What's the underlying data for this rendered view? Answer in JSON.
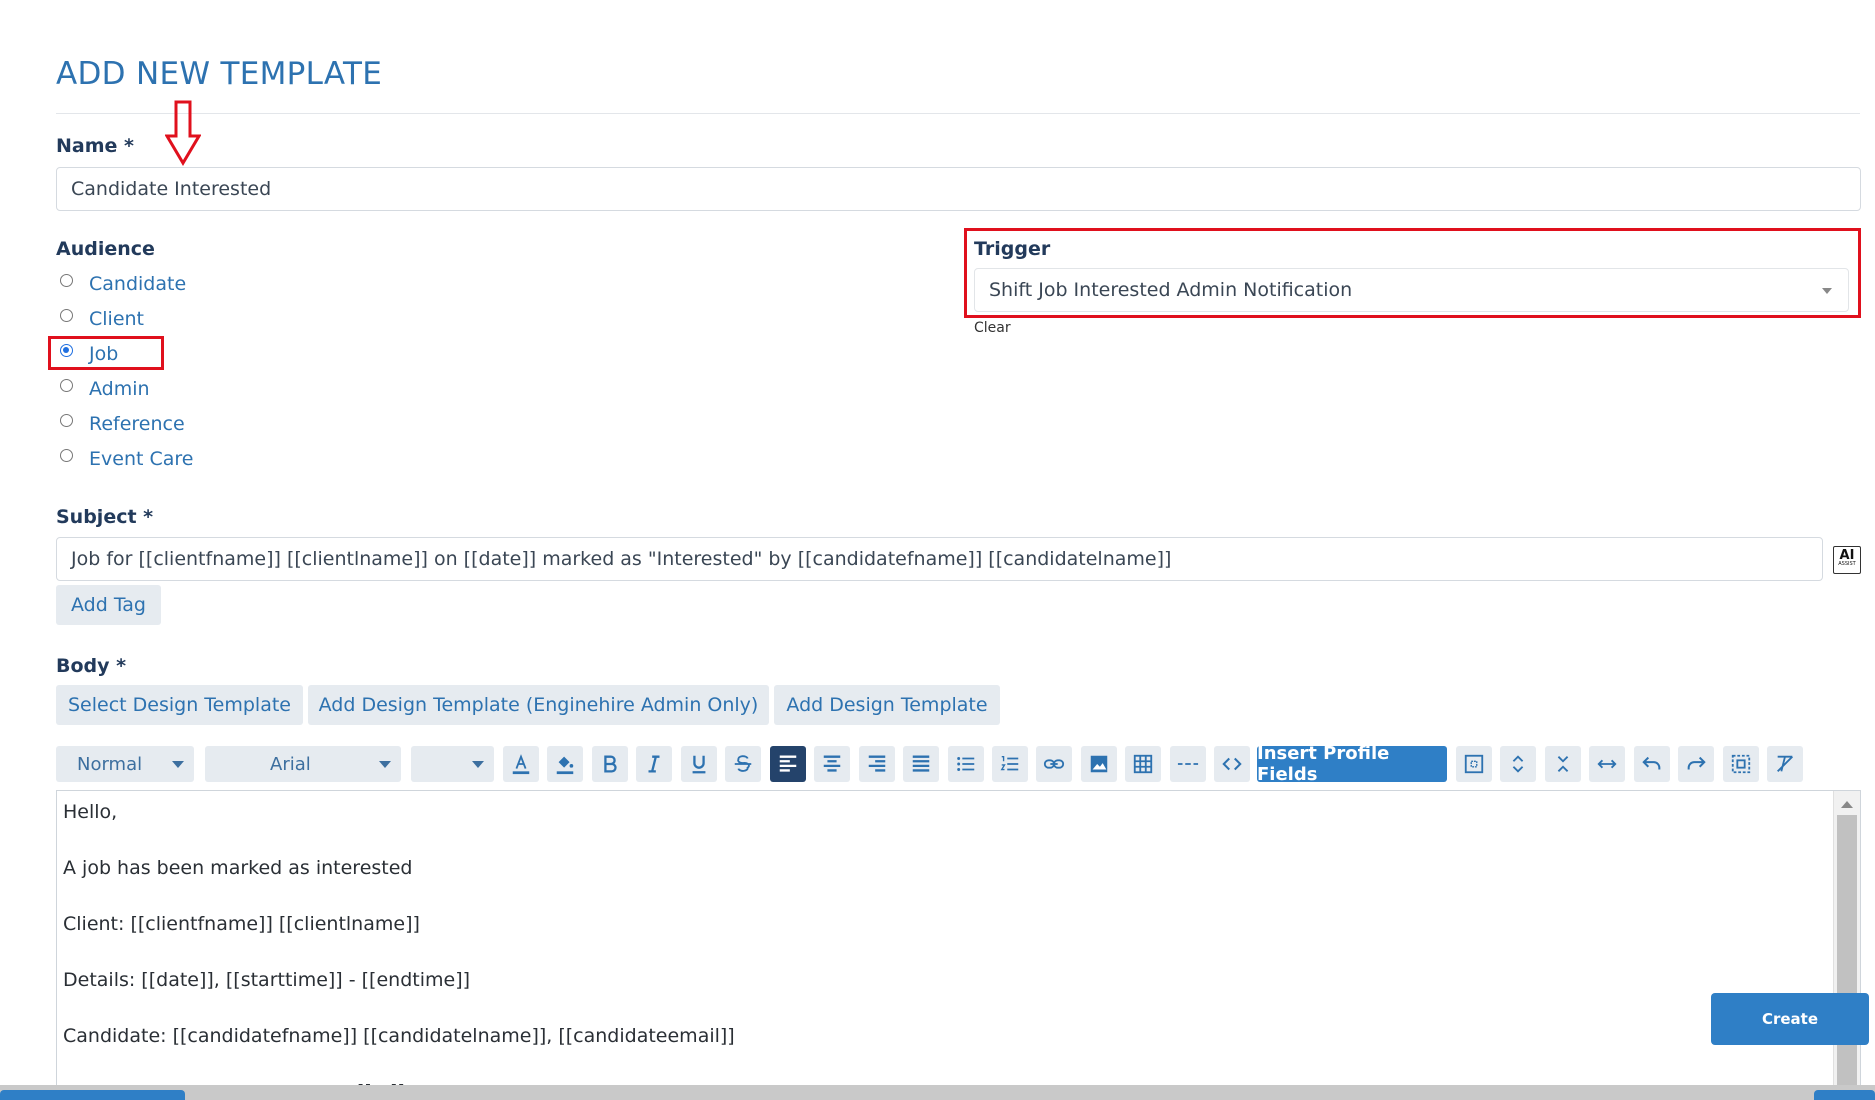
{
  "page": {
    "title": "ADD NEW TEMPLATE"
  },
  "name": {
    "label": "Name *",
    "value": "Candidate Interested"
  },
  "audience": {
    "label": "Audience",
    "options": [
      "Candidate",
      "Client",
      "Job",
      "Admin",
      "Reference",
      "Event Care"
    ],
    "selected": "Job"
  },
  "trigger": {
    "label": "Trigger",
    "value": "Shift Job Interested Admin Notification",
    "clear_label": "Clear"
  },
  "subject": {
    "label": "Subject *",
    "value": "Job for [[clientfname]] [[clientlname]] on [[date]] marked as \"Interested\" by [[candidatefname]] [[candidatelname]]",
    "add_tag_label": "Add Tag",
    "ai_assist": {
      "main": "AI",
      "sub": "ASSIST"
    }
  },
  "body": {
    "label": "Body *",
    "design_buttons": [
      "Select Design Template",
      "Add Design Template (Enginehire Admin Only)",
      "Add Design Template"
    ],
    "toolbar": {
      "format_value": "Normal",
      "font_value": "Arial",
      "size_value": "",
      "insert_profile_fields_label": "Insert Profile Fields",
      "icons": [
        "font-color-icon",
        "fill-color-icon",
        "bold-icon",
        "italic-icon",
        "underline-icon",
        "strikethrough-icon",
        "align-left-icon",
        "align-center-icon",
        "align-right-icon",
        "align-justify-icon",
        "bullet-list-icon",
        "numbered-list-icon",
        "link-icon",
        "image-icon",
        "table-icon",
        "horizontal-rule-icon",
        "code-view-icon",
        "select-all-icon",
        "expand-vertical-icon",
        "collapse-vertical-icon",
        "expand-horizontal-icon",
        "undo-icon",
        "redo-icon",
        "fullscreen-icon",
        "clear-formatting-icon"
      ]
    },
    "content_lines": [
      "Hello,",
      "A job has been marked as interested",
      "Client: [[clientfname]] [[clientlname]]",
      "Details: [[date]], [[starttime]] - [[endtime]]",
      "Candidate: [[candidatefname]] [[candidatelname]], [[candidateemail]]",
      "[[...]]"
    ]
  },
  "actions": {
    "create_label": "Create"
  },
  "colors": {
    "accent": "#2d72b0",
    "highlight": "#e0101d",
    "button_bg": "#e6ebf0"
  }
}
